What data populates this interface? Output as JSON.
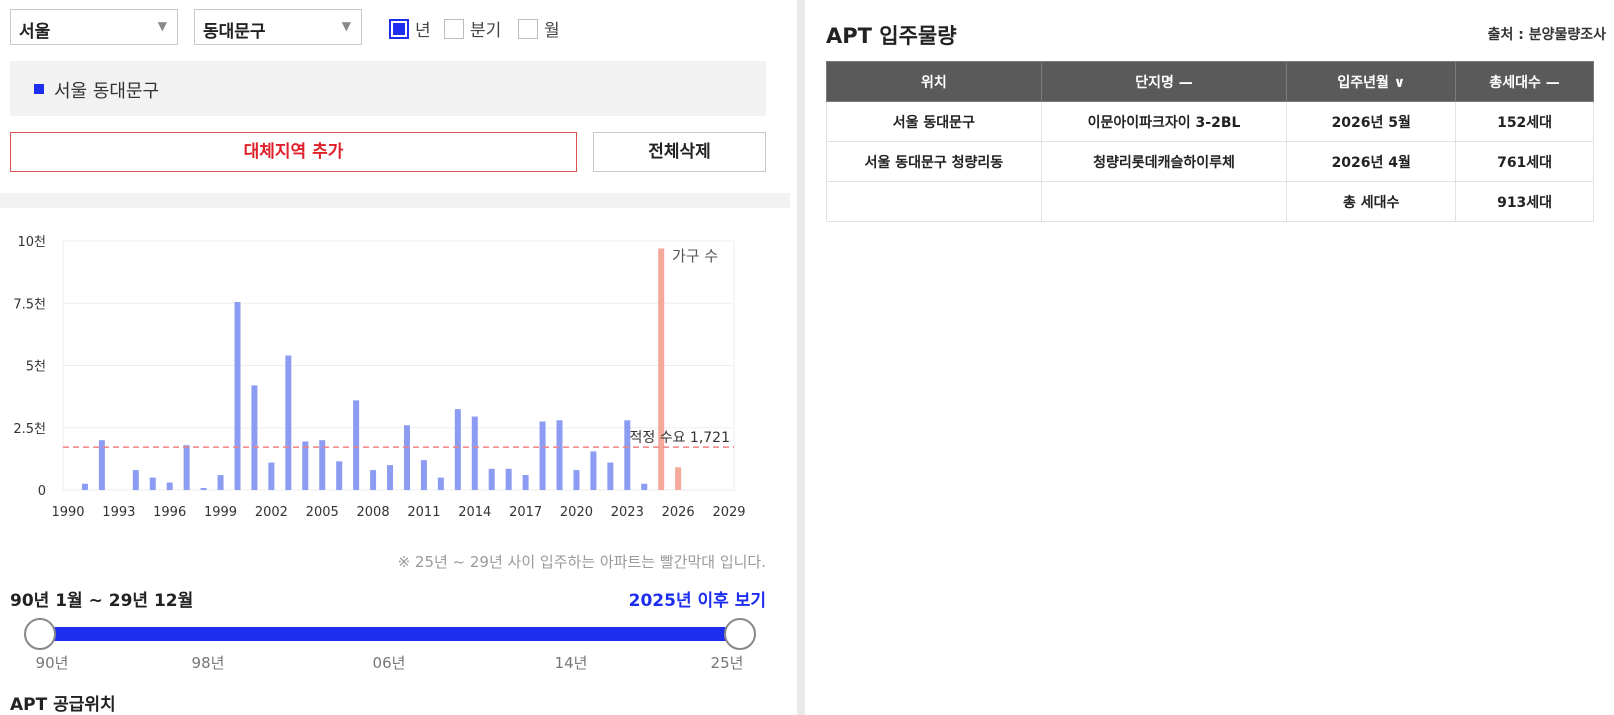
{
  "filters": {
    "city": "서울",
    "district": "동대문구",
    "periods": [
      {
        "label": "년",
        "checked": true
      },
      {
        "label": "분기",
        "checked": false
      },
      {
        "label": "월",
        "checked": false
      }
    ]
  },
  "region_label": "서울 동대문구",
  "buttons": {
    "add": "대체지역 추가",
    "delete_all": "전체삭제"
  },
  "chart_note": "※ 25년 ~ 29년 사이 입주하는 아파트는 빨간막대 입니다.",
  "period_text": "90년 1월 ~ 29년 12월",
  "future_link": "2025년 이후 보기",
  "slider": {
    "ticks": [
      "90년",
      "98년",
      "06년",
      "14년",
      "25년"
    ],
    "start": "90년",
    "end": "25년"
  },
  "supply_title": "APT 공급위치",
  "right": {
    "title": "APT 입주물량",
    "source": "출처 : 분양물량조사",
    "table": {
      "headers": [
        "위치",
        "단지명 —",
        "입주년월 ∨",
        "총세대수 —"
      ],
      "rows": [
        [
          "서울 동대문구",
          "이문아이파크자이 3-2BL",
          "2026년 5월",
          "152세대"
        ],
        [
          "서울 동대문구 청량리동",
          "청량리롯데캐슬하이루체",
          "2026년 4월",
          "761세대"
        ],
        [
          "",
          "",
          "총 세대수",
          "913세대"
        ]
      ]
    }
  },
  "colors": {
    "accent": "#1e2ef0",
    "past_bar": "#8c9cf2",
    "future_bar": "#f5a99a",
    "demand_line": "#f08080"
  },
  "chart_data": {
    "type": "bar",
    "yticks": [
      "10천",
      "7.5천",
      "5천",
      "2.5천",
      "0"
    ],
    "ylim": [
      0,
      10000
    ],
    "xticks": [
      "1990",
      "1993",
      "1996",
      "1999",
      "2002",
      "2005",
      "2008",
      "2011",
      "2014",
      "2017",
      "2020",
      "2023",
      "2026",
      "2029"
    ],
    "xlim": [
      1990,
      2029
    ],
    "series_label": "가구 수",
    "demand_label": "적정 수요 1,721",
    "demand_value": 1721,
    "bars": [
      {
        "year": 1991,
        "value": 250,
        "future": false
      },
      {
        "year": 1992,
        "value": 2000,
        "future": false
      },
      {
        "year": 1994,
        "value": 800,
        "future": false
      },
      {
        "year": 1995,
        "value": 500,
        "future": false
      },
      {
        "year": 1996,
        "value": 300,
        "future": false
      },
      {
        "year": 1997,
        "value": 1800,
        "future": false
      },
      {
        "year": 1998,
        "value": 80,
        "future": false
      },
      {
        "year": 1999,
        "value": 600,
        "future": false
      },
      {
        "year": 2000,
        "value": 7550,
        "future": false
      },
      {
        "year": 2001,
        "value": 4200,
        "future": false
      },
      {
        "year": 2002,
        "value": 1100,
        "future": false
      },
      {
        "year": 2003,
        "value": 5400,
        "future": false
      },
      {
        "year": 2004,
        "value": 1950,
        "future": false
      },
      {
        "year": 2005,
        "value": 2000,
        "future": false
      },
      {
        "year": 2006,
        "value": 1150,
        "future": false
      },
      {
        "year": 2007,
        "value": 3600,
        "future": false
      },
      {
        "year": 2008,
        "value": 800,
        "future": false
      },
      {
        "year": 2009,
        "value": 1000,
        "future": false
      },
      {
        "year": 2010,
        "value": 2600,
        "future": false
      },
      {
        "year": 2011,
        "value": 1200,
        "future": false
      },
      {
        "year": 2012,
        "value": 500,
        "future": false
      },
      {
        "year": 2013,
        "value": 3250,
        "future": false
      },
      {
        "year": 2014,
        "value": 2950,
        "future": false
      },
      {
        "year": 2015,
        "value": 850,
        "future": false
      },
      {
        "year": 2016,
        "value": 850,
        "future": false
      },
      {
        "year": 2017,
        "value": 600,
        "future": false
      },
      {
        "year": 2018,
        "value": 2750,
        "future": false
      },
      {
        "year": 2019,
        "value": 2800,
        "future": false
      },
      {
        "year": 2020,
        "value": 800,
        "future": false
      },
      {
        "year": 2021,
        "value": 1550,
        "future": false
      },
      {
        "year": 2022,
        "value": 1100,
        "future": false
      },
      {
        "year": 2023,
        "value": 2800,
        "future": false
      },
      {
        "year": 2024,
        "value": 250,
        "future": false
      },
      {
        "year": 2025,
        "value": 9700,
        "future": true
      },
      {
        "year": 2026,
        "value": 913,
        "future": true
      }
    ]
  }
}
